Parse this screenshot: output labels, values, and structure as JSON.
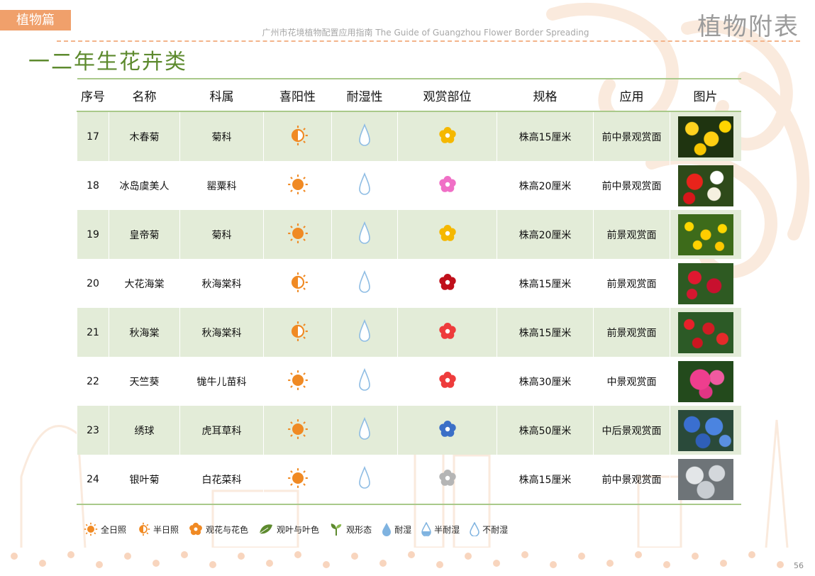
{
  "header": {
    "section_tag": "植物篇",
    "subtitle": "广州市花境植物配置应用指南 The Guide of Guangzhou Flower Border Spreading",
    "appendix_title": "植物附表"
  },
  "page_title": "一二年生花卉类",
  "table": {
    "headers": [
      "序号",
      "名称",
      "科属",
      "喜阳性",
      "耐湿性",
      "观赏部位",
      "规格",
      "应用",
      "图片"
    ],
    "rows": [
      {
        "no": "17",
        "name": "木春菊",
        "family": "菊科",
        "sun": "half-sun-icon",
        "moisture": "not-moisture-tolerant-icon",
        "part": "flower-icon",
        "part_color": "#f5b800",
        "spec": "株高15厘米",
        "use": "前中景观赏面",
        "photo": "yellow-daisy-photo"
      },
      {
        "no": "18",
        "name": "冰岛虞美人",
        "family": "罂粟科",
        "sun": "full-sun-icon",
        "moisture": "not-moisture-tolerant-icon",
        "part": "flower-icon",
        "part_color": "#f06fc6",
        "spec": "株高20厘米",
        "use": "前中景观赏面",
        "photo": "red-white-poppy-photo"
      },
      {
        "no": "19",
        "name": "皇帝菊",
        "family": "菊科",
        "sun": "full-sun-icon",
        "moisture": "not-moisture-tolerant-icon",
        "part": "flower-icon",
        "part_color": "#f5b800",
        "spec": "株高20厘米",
        "use": "前景观赏面",
        "photo": "yellow-melampodium-photo"
      },
      {
        "no": "20",
        "name": "大花海棠",
        "family": "秋海棠科",
        "sun": "half-sun-icon",
        "moisture": "not-moisture-tolerant-icon",
        "part": "flower-icon",
        "part_color": "#c0101b",
        "spec": "株高15厘米",
        "use": "前景观赏面",
        "photo": "red-begonia-photo"
      },
      {
        "no": "21",
        "name": "秋海棠",
        "family": "秋海棠科",
        "sun": "half-sun-icon",
        "moisture": "not-moisture-tolerant-icon",
        "part": "flower-icon",
        "part_color": "#ee3c3c",
        "spec": "株高15厘米",
        "use": "前景观赏面",
        "photo": "red-begonia-bed-photo"
      },
      {
        "no": "22",
        "name": "天竺葵",
        "family": "牻牛儿苗科",
        "sun": "full-sun-icon",
        "moisture": "not-moisture-tolerant-icon",
        "part": "flower-icon",
        "part_color": "#ee3c3c",
        "spec": "株高30厘米",
        "use": "中景观赏面",
        "photo": "pink-geranium-photo"
      },
      {
        "no": "23",
        "name": "绣球",
        "family": "虎耳草科",
        "sun": "full-sun-icon",
        "moisture": "not-moisture-tolerant-icon",
        "part": "flower-icon",
        "part_color": "#3b6fc7",
        "spec": "株高50厘米",
        "use": "中后景观赏面",
        "photo": "blue-hydrangea-photo"
      },
      {
        "no": "24",
        "name": "银叶菊",
        "family": "白花菜科",
        "sun": "full-sun-icon",
        "moisture": "not-moisture-tolerant-icon",
        "part": "flower-icon",
        "part_color": "#b5b5b5",
        "spec": "株高15厘米",
        "use": "前中景观赏面",
        "photo": "silver-dusty-miller-photo"
      }
    ]
  },
  "legend": {
    "full_sun": "全日照",
    "half_sun": "半日照",
    "flower": "观花与花色",
    "foliage": "观叶与叶色",
    "form": "观形态",
    "wet": "耐湿",
    "half_wet": "半耐湿",
    "not_wet": "不耐湿"
  },
  "page_number": "56",
  "colors": {
    "accent_orange": "#f0a06b",
    "title_green": "#5d8a2e",
    "row_green": "#e3ecd8",
    "sun_orange": "#f08a24",
    "water_blue": "#7fb3e0"
  }
}
